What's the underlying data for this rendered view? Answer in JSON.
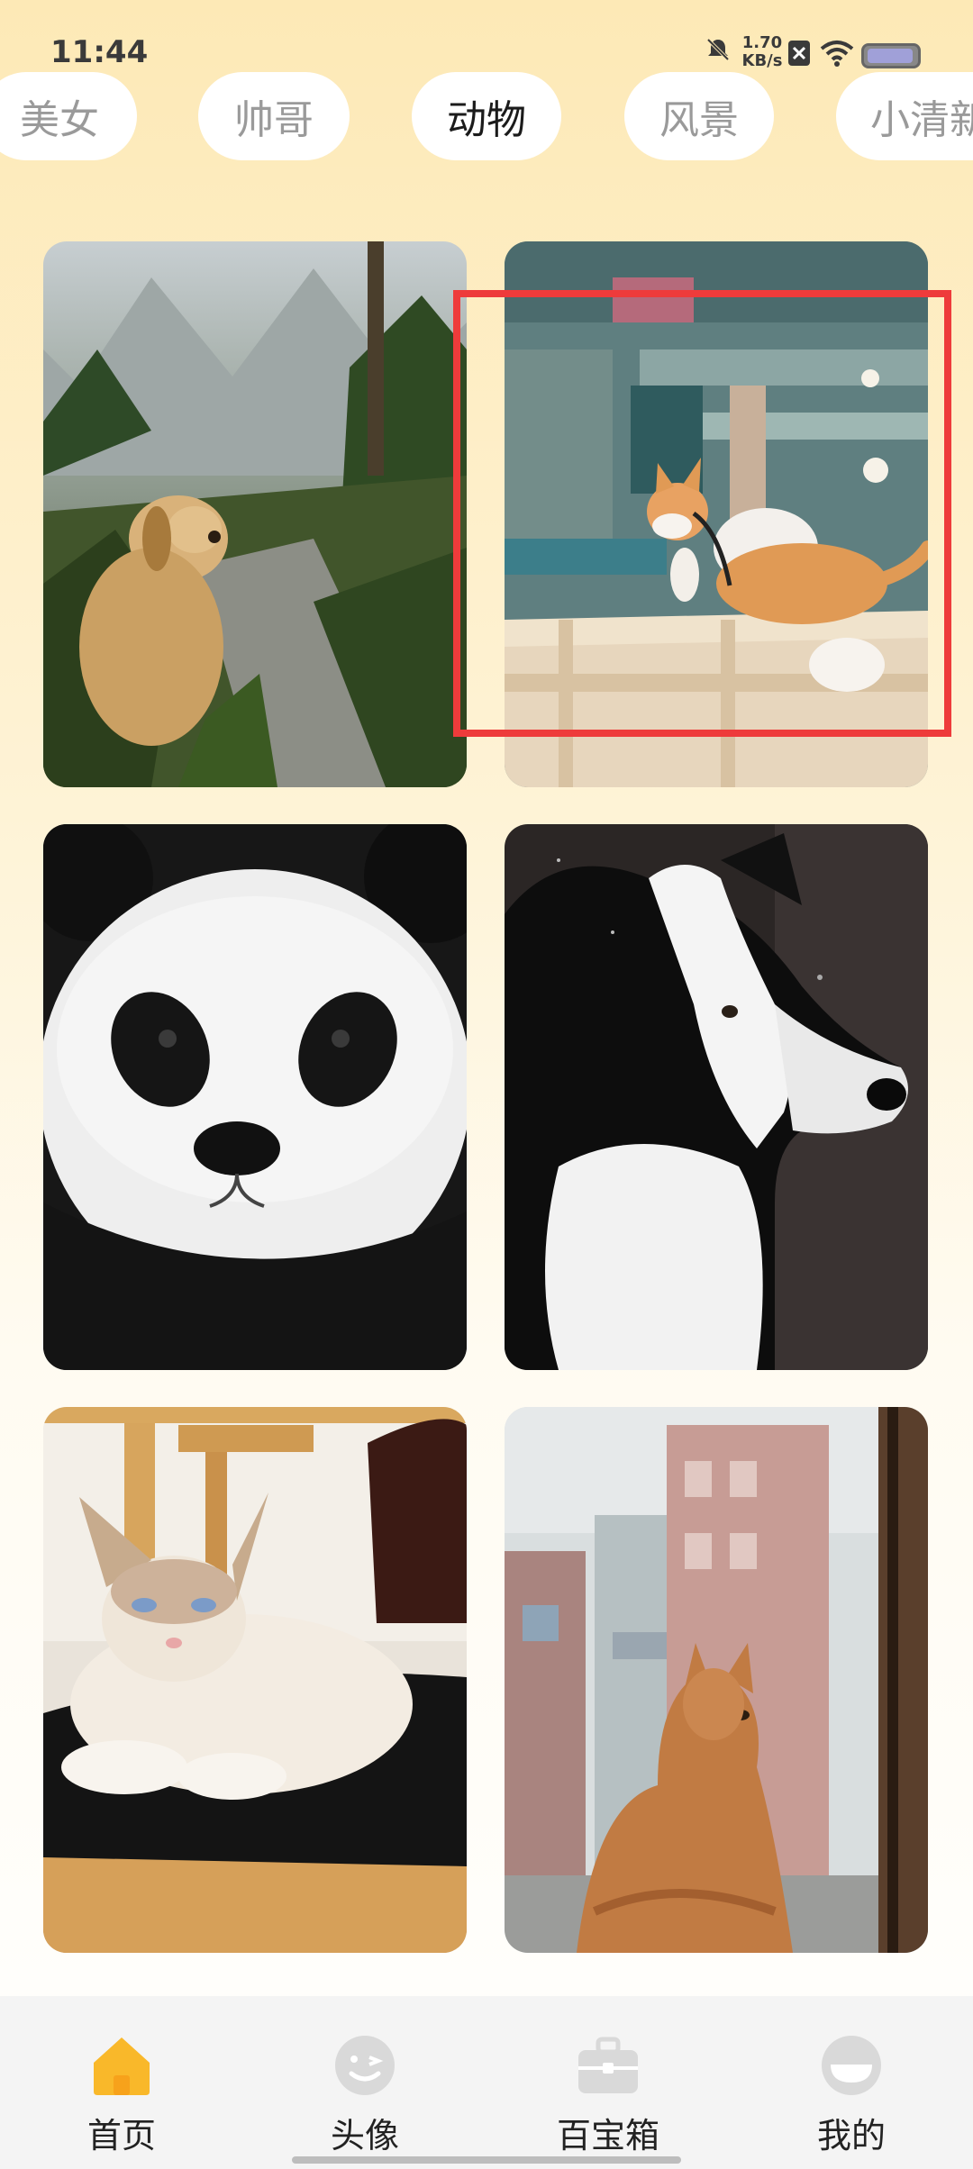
{
  "status_bar": {
    "time": "11:44",
    "net_speed_value": "1.70",
    "net_speed_unit": "KB/s"
  },
  "tabs": [
    {
      "label": "美女",
      "active": false
    },
    {
      "label": "帅哥",
      "active": false
    },
    {
      "label": "动物",
      "active": true
    },
    {
      "label": "风景",
      "active": false
    },
    {
      "label": "小清新",
      "active": false
    }
  ],
  "grid": {
    "items": [
      {
        "subject": "golden retriever on forest path"
      },
      {
        "subject": "orange and white kitten on wooden frame"
      },
      {
        "subject": "panda face"
      },
      {
        "subject": "black and white border collie"
      },
      {
        "subject": "ragdoll cat on chair"
      },
      {
        "subject": "orange cat at window"
      }
    ]
  },
  "highlight_color": "#EE3B3B",
  "bottom_nav": [
    {
      "label": "首页",
      "icon": "home-icon",
      "active": true
    },
    {
      "label": "头像",
      "icon": "avatar-face-icon",
      "active": false
    },
    {
      "label": "百宝箱",
      "icon": "toolbox-icon",
      "active": false
    },
    {
      "label": "我的",
      "icon": "profile-icon",
      "active": false
    }
  ],
  "colors": {
    "accent": "#F9B82A",
    "inactive_icon": "#D9D9D9"
  }
}
